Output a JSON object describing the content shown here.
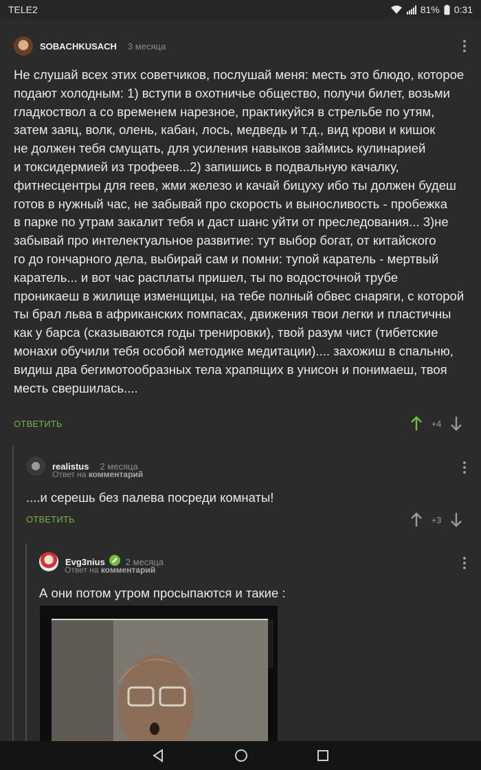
{
  "status_bar": {
    "carrier": "TELE2",
    "battery": "81%",
    "time": "0:31",
    "icons": [
      "wifi-icon",
      "signal-icon",
      "battery-icon"
    ]
  },
  "comments": [
    {
      "username": "SOBACHKUSACH",
      "time": "3 месяца",
      "lines": [
        "Не слушай всех этих советчиков, послушай меня: месть это блюдо, которое",
        "подают холодным: 1) вступи в охотничье общество, получи билет, возьми",
        "гладкоствол а со временем нарезное, практикуйся в стрельбе по утям,",
        "затем заяц, волк, олень, кабан, лось, медведь и т.д., вид крови и кишок",
        "не должен тебя смущать, для усиления навыков займись кулинарией",
        "и токсидермией из трофеев...2) запишись в подвальную качалку,",
        "фитнесцентры для геев, жми железо и качай бицуху ибо ты должен будеш",
        "готов в нужный час, не забывай про скорость и выносливость - пробежка",
        "в парке по утрам закалит тебя и даст шанс уйти от преследования... 3)не",
        "забывай про интелектуальное развитие: тут выбор богат, от китайского",
        "го до гончарного дела, выбирай сам и помни: тупой каратель - мертвый",
        "каратель...  и вот час расплаты пришел, ты по водосточной трубе",
        "проникаеш в жилище изменщицы, на тебе полный обвес снаряги, с которой",
        "ты брал льва в африканских помпасах, движения твои легки и пластичны",
        "как у барса (сказываются годы тренировки), твой разум чист (тибетские",
        "монахи обучили тебя особой методике медитации).... захожиш в спальню,",
        "видиш два бегимотообразных тела храпящих в унисон и понимаеш, твоя",
        "месть свершилась...."
      ],
      "reply_label": "ОТВЕТИТЬ",
      "rating": "+4",
      "upvote_color": "#6fbf3c"
    },
    {
      "username": "realistus",
      "time": "2 месяца",
      "reply_to_prefix": "Ответ на",
      "reply_to_link": "комментарий",
      "text": "....и серешь без палева посреди комнаты!",
      "reply_label": "ОТВЕТИТЬ",
      "rating": "+3"
    },
    {
      "username": "Evg3nius",
      "time": "2 месяца",
      "reply_to_prefix": "Ответ на",
      "reply_to_link": "комментарий",
      "text": "А они потом утром просыпаются и такие :",
      "badge_color": "#6fbf3c"
    }
  ],
  "colors": {
    "background": "#2b2b2b",
    "accent_green": "#7eb04a",
    "muted": "#8c8c8c"
  }
}
